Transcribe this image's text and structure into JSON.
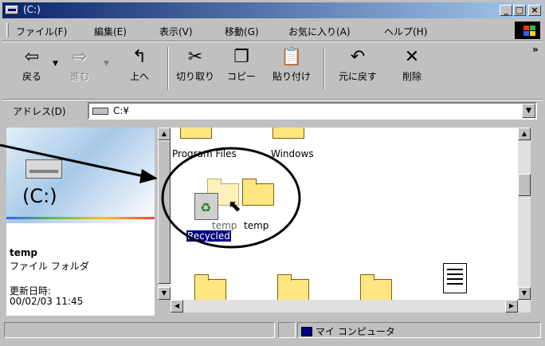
{
  "window": {
    "title": "(C:)"
  },
  "title_buttons": {
    "minimize": "_",
    "maximize": "□",
    "close": "×"
  },
  "menu": [
    "ファイル(F)",
    "編集(E)",
    "表示(V)",
    "移動(G)",
    "お気に入り(A)",
    "ヘルプ(H)"
  ],
  "toolbar": {
    "back": {
      "label": "戻る",
      "icon": "⇦"
    },
    "forward": {
      "label": "進む",
      "icon": "⇨"
    },
    "up": {
      "label": "上へ",
      "icon": "↰"
    },
    "cut": {
      "label": "切り取り",
      "icon": "✂"
    },
    "copy": {
      "label": "コピー",
      "icon": "❐"
    },
    "paste": {
      "label": "貼り付け",
      "icon": "📋"
    },
    "undo": {
      "label": "元に戻す",
      "icon": "↶"
    },
    "delete": {
      "label": "削除",
      "icon": "✕"
    },
    "more": "»"
  },
  "address": {
    "label": "アドレス(D)",
    "value": "C:¥"
  },
  "left_pane": {
    "title": "(C:)",
    "selected_name": "temp",
    "selected_type": "ファイル フォルダ",
    "modified_label": "更新日時:",
    "modified_value": "00/02/03 11:45"
  },
  "files": {
    "program_files": "Program Files",
    "windows": "Windows",
    "temp_drag": "temp",
    "temp": "temp",
    "recycled": "Recycled"
  },
  "status": {
    "zone": "マイ コンピュータ"
  },
  "colors": {
    "titlebar_start": "#0a246a",
    "titlebar_end": "#a6caf0",
    "selection": "#000080"
  }
}
